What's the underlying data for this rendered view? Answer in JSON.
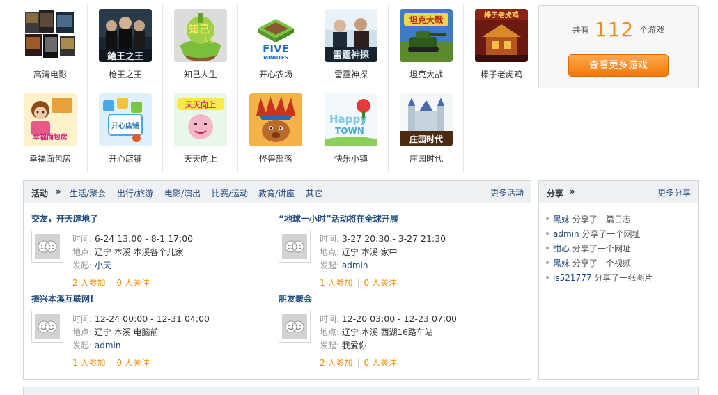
{
  "games": [
    {
      "label": "高清电影",
      "icon": "movie-collage-icon"
    },
    {
      "label": "枪王之王",
      "icon": "gun-king-icon"
    },
    {
      "label": "知己人生",
      "icon": "zhiji-life-icon"
    },
    {
      "label": "开心农场",
      "icon": "happy-farm-icon"
    },
    {
      "label": "雷霆神探",
      "icon": "thunder-detective-icon"
    },
    {
      "label": "坦克大战",
      "icon": "tank-battle-icon"
    },
    {
      "label": "棒子老虎鸡",
      "icon": "stick-tiger-chicken-icon"
    },
    {
      "label": "幸福面包房",
      "icon": "bakery-icon"
    },
    {
      "label": "开心店铺",
      "icon": "happy-shop-icon"
    },
    {
      "label": "天天向上",
      "icon": "tiantian-icon"
    },
    {
      "label": "怪兽部落",
      "icon": "monster-tribe-icon"
    },
    {
      "label": "快乐小镇",
      "icon": "happy-town-icon"
    },
    {
      "label": "庄园时代",
      "icon": "manor-era-icon"
    }
  ],
  "game_art_text": {
    "gun": "鎗王之王",
    "zhiji_a": "知己",
    "zhiji_b": "人生",
    "five_a": "FIVE",
    "five_b": "MINUTES",
    "thunder": "雷霆神探",
    "tank": "坦克大戰",
    "bangzi": "棒子老虎鸡",
    "bakery": "幸福面包房",
    "shop": "开心店铺",
    "tiantian": "天天向上",
    "town_a": "Happy",
    "town_b": "TOWN",
    "manor": "庄园时代"
  },
  "count_box": {
    "prefix": "共有",
    "count": "112",
    "suffix": "个游戏",
    "button": "查看更多游戏"
  },
  "activities": {
    "title": "活动",
    "arrow": "»",
    "categories": [
      "生活/聚会",
      "出行/旅游",
      "电影/演出",
      "比赛/运动",
      "教育/讲座",
      "其它"
    ],
    "more": "更多活动",
    "labels": {
      "time": "时间:",
      "place": "地点:",
      "initiator": "发起:"
    },
    "events": [
      {
        "title": "交友，开天辟地了",
        "time": "6-24 13:00 - 8-1 17:00",
        "place": "辽宁  本溪  本溪各个儿家",
        "initiator": "小天",
        "joined": "2 人参加",
        "follow": "0 人关注"
      },
      {
        "title": "“地球一小时”活动将在全球开展",
        "time": "3-27 20:30 - 3-27 21:30",
        "place": "辽宁  本溪  家中",
        "initiator": "admin",
        "joined": "1 人参加",
        "follow": "0 人关注"
      },
      {
        "title": "振兴本溪互联网!",
        "time": "12-24 00:00 - 12-31 04:00",
        "place": "辽宁  本溪  电脑前",
        "initiator": "admin",
        "joined": "1 人参加",
        "follow": "0 人关注"
      },
      {
        "title": "朋友聚会",
        "time": "12-20 03:00 - 12-23 07:00",
        "place": "辽宁  本溪  西湖16路车站",
        "initiator": "我爱你",
        "joined": "2 人参加",
        "follow": "0 人关注"
      }
    ]
  },
  "share": {
    "title": "分享",
    "arrow": "»",
    "more": "更多分享",
    "items": [
      {
        "user": "黑妹",
        "action": "分享了一篇日志"
      },
      {
        "user": "admin",
        "action": "分享了一个网址"
      },
      {
        "user": "甜心",
        "action": "分享了一个网址"
      },
      {
        "user": "黑妹",
        "action": "分享了一个视频"
      },
      {
        "user": "ls521777",
        "action": "分享了一张图片"
      }
    ]
  }
}
